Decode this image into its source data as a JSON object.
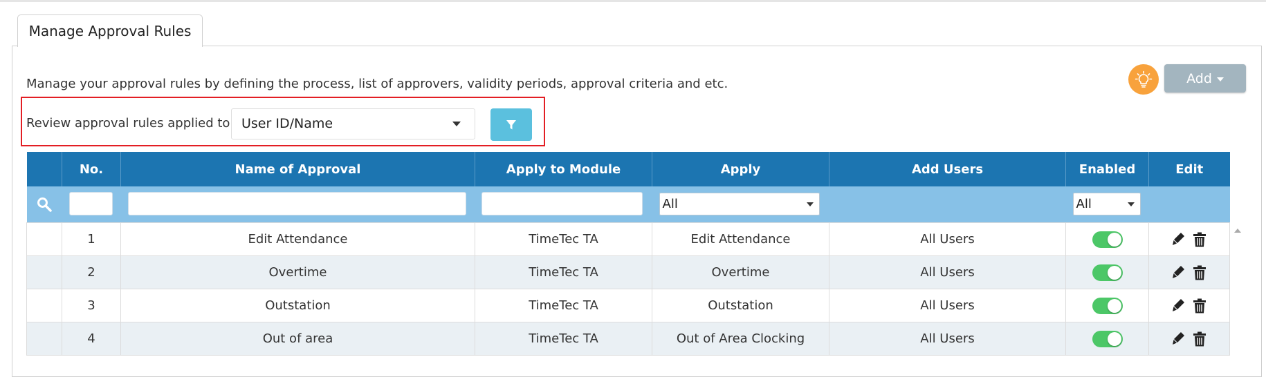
{
  "tab": {
    "label": "Manage Approval Rules"
  },
  "description": "Manage your approval rules by defining the process, list of approvers, validity periods, approval criteria and etc.",
  "toolbar": {
    "add_label": "Add",
    "tip_icon": "lightbulb-icon"
  },
  "review": {
    "label": "Review approval rules applied to",
    "selected": "User ID/Name"
  },
  "table": {
    "headers": [
      "No.",
      "Name of Approval",
      "Apply to Module",
      "Apply",
      "Add Users",
      "Enabled",
      "Edit"
    ],
    "filters": {
      "apply": "All",
      "enabled": "All"
    },
    "rows": [
      {
        "no": "1",
        "name": "Edit Attendance",
        "module": "TimeTec TA",
        "apply": "Edit Attendance",
        "users": "All Users",
        "enabled": true
      },
      {
        "no": "2",
        "name": "Overtime",
        "module": "TimeTec TA",
        "apply": "Overtime",
        "users": "All Users",
        "enabled": true
      },
      {
        "no": "3",
        "name": "Outstation",
        "module": "TimeTec TA",
        "apply": "Outstation",
        "users": "All Users",
        "enabled": true
      },
      {
        "no": "4",
        "name": "Out of area",
        "module": "TimeTec TA",
        "apply": "Out of Area Clocking",
        "users": "All Users",
        "enabled": true
      }
    ]
  },
  "colors": {
    "header": "#1c75b1",
    "filter_row": "#87c1e7",
    "toggle_on": "#4cc767",
    "highlight_border": "#e31e24",
    "add_button": "#a3b5bf",
    "filter_button": "#5bc0de",
    "tip_button": "#f8a23c"
  }
}
